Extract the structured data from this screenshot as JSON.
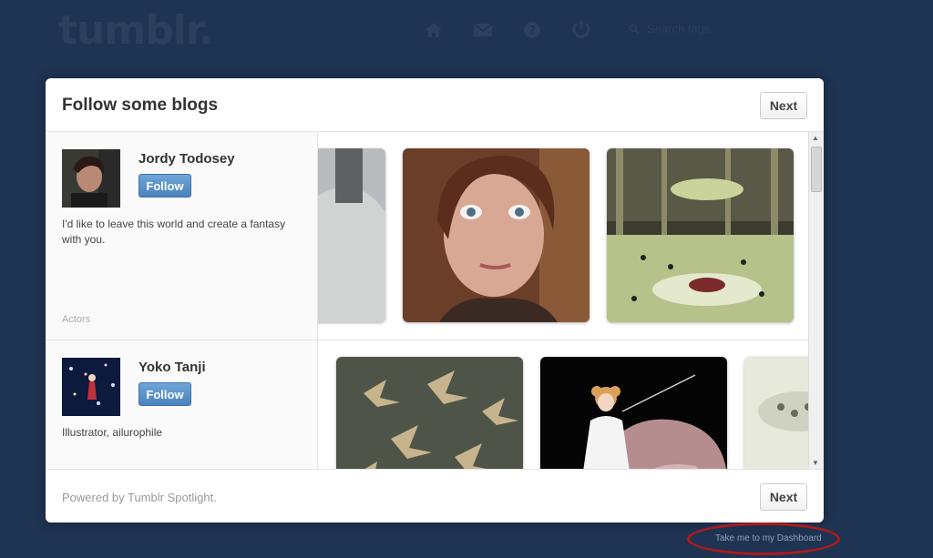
{
  "header": {
    "logo_text": "tumblr.",
    "search_placeholder": "Search tags",
    "icons": [
      "home-icon",
      "mail-icon",
      "help-icon",
      "power-icon",
      "search-icon"
    ]
  },
  "modal": {
    "title": "Follow some blogs",
    "next_label": "Next",
    "footer_next_label": "Next",
    "powered_by": "Powered by Tumblr Spotlight."
  },
  "blogs": [
    {
      "name": "Jordy Todosey",
      "follow_label": "Follow",
      "description": "I'd like to leave this world and create a fantasy with you.",
      "category": "Actors"
    },
    {
      "name": "Yoko Tanji",
      "follow_label": "Follow",
      "description": "Illustrator, ailurophile",
      "category": ""
    }
  ],
  "dashboard_link": "Take me to my Dashboard",
  "colors": {
    "background": "#1f3452",
    "follow_button": "#4b82bd",
    "highlight_circle": "#b0191e"
  }
}
